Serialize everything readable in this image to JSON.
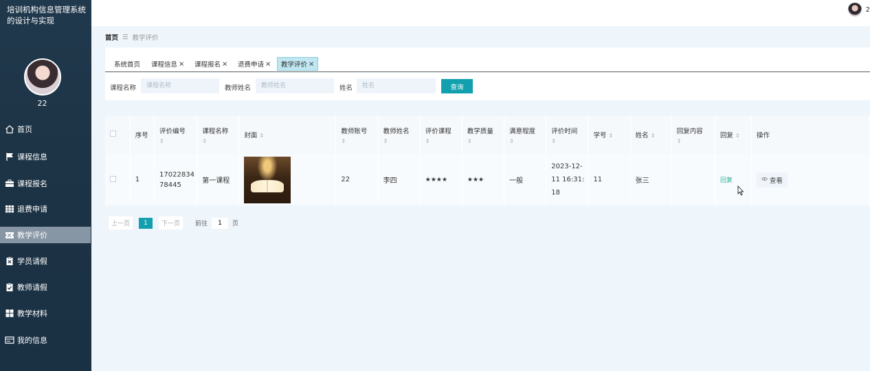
{
  "app": {
    "title": "培训机构信息管理系统的设计与实现",
    "user_name": "22",
    "top_user": "2"
  },
  "sidebar": {
    "items": [
      {
        "label": "首页",
        "icon": "home-icon"
      },
      {
        "label": "课程信息",
        "icon": "flag-icon"
      },
      {
        "label": "课程报名",
        "icon": "briefcase-icon"
      },
      {
        "label": "退费申请",
        "icon": "grid-icon"
      },
      {
        "label": "教学评价",
        "icon": "ticket-icon",
        "active": true
      },
      {
        "label": "学员请假",
        "icon": "clipboard-x-icon"
      },
      {
        "label": "教师请假",
        "icon": "clipboard-check-icon"
      },
      {
        "label": "教学材料",
        "icon": "apps-icon"
      },
      {
        "label": "我的信息",
        "icon": "card-icon"
      }
    ]
  },
  "breadcrumb": {
    "home": "首页",
    "separator": "☰",
    "current": "教学评价"
  },
  "tabs": [
    {
      "label": "系统首页",
      "closable": false
    },
    {
      "label": "课程信息",
      "closable": true
    },
    {
      "label": "课程报名",
      "closable": true
    },
    {
      "label": "退费申请",
      "closable": true
    },
    {
      "label": "教学评价",
      "closable": true,
      "active": true
    }
  ],
  "search": {
    "course_label": "课程名称",
    "course_placeholder": "课程名称",
    "teacher_label": "教师姓名",
    "teacher_placeholder": "教师姓名",
    "name_label": "姓名",
    "name_placeholder": "姓名",
    "button": "查询"
  },
  "table": {
    "headers": [
      "序号",
      "评价编号",
      "课程名称",
      "封面",
      "教师账号",
      "教师姓名",
      "评价课程",
      "教学质量",
      "满意程度",
      "评价时间",
      "学号",
      "姓名",
      "回复内容",
      "回复",
      "操作"
    ],
    "rows": [
      {
        "index": "1",
        "eval_no": "1702283478445",
        "eval_no_l1": "17022834",
        "eval_no_l2": "78445",
        "course": "第一课程",
        "teacher_account": "22",
        "teacher_name": "李四",
        "course_rating": "★★★★",
        "quality": "★★★",
        "satisfaction": "一般",
        "time": "2023-12-11 16:31:18",
        "time_l1": "2023-12-",
        "time_l2": "11 16:31:",
        "time_l3": "18",
        "student_no": "11",
        "student_name": "张三",
        "reply_content": "",
        "reply_action": "回复",
        "view": "查看"
      }
    ]
  },
  "pagination": {
    "prev": "上一页",
    "current": "1",
    "next": "下一页",
    "goto": "前往",
    "page_value": "1",
    "page_suffix": "页"
  },
  "colors": {
    "sidebar_bg": "#1d3446",
    "accent": "#12a0ae",
    "reply": "#2ab29a"
  }
}
